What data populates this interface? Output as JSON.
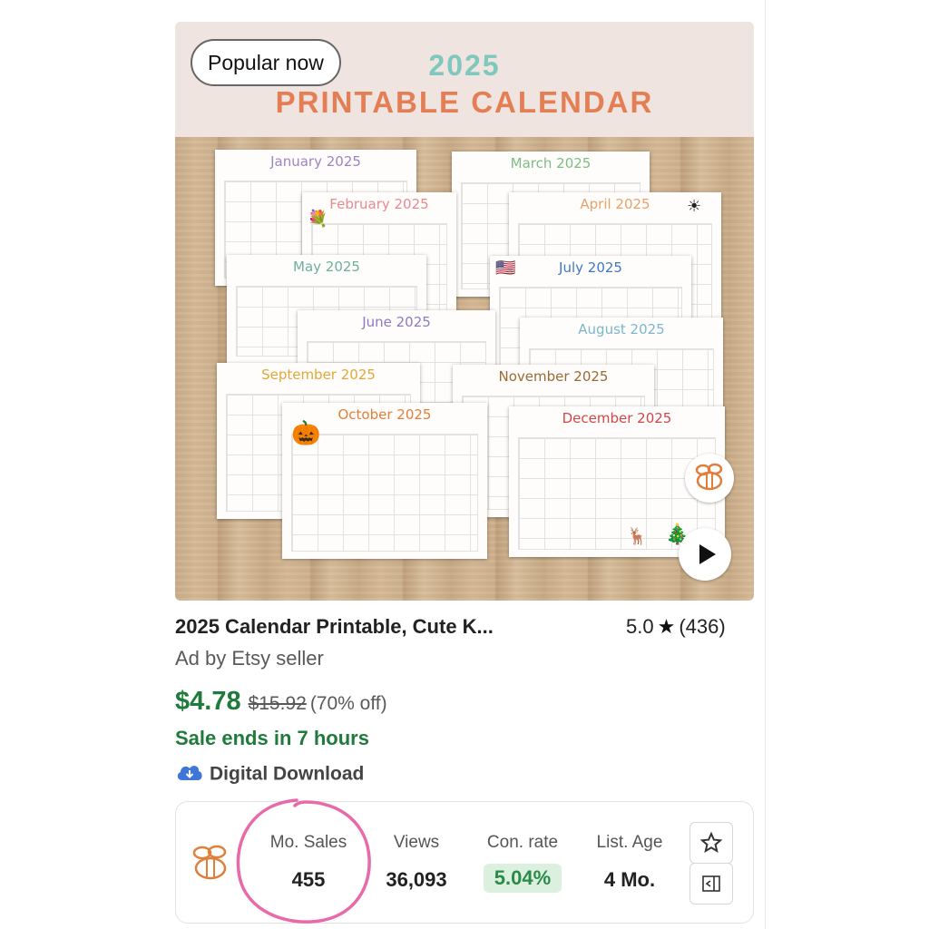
{
  "image": {
    "badge": "Popular now",
    "banner_year": "2025",
    "banner_title": "PRINTABLE CALENDAR",
    "calendars": [
      {
        "month": "January 2025",
        "color": "#9b86c4"
      },
      {
        "month": "March 2025",
        "color": "#7bbd86"
      },
      {
        "month": "February 2025",
        "color": "#e58a92"
      },
      {
        "month": "April 2025",
        "color": "#e7a268"
      },
      {
        "month": "May 2025",
        "color": "#6eaf9e"
      },
      {
        "month": "July 2025",
        "color": "#3f79c4"
      },
      {
        "month": "June 2025",
        "color": "#8d7ac0"
      },
      {
        "month": "August 2025",
        "color": "#7ab7cc"
      },
      {
        "month": "September 2025",
        "color": "#e0a83a"
      },
      {
        "month": "November 2025",
        "color": "#9a6a36"
      },
      {
        "month": "October 2025",
        "color": "#e07f3a"
      },
      {
        "month": "December 2025",
        "color": "#d2464b"
      }
    ]
  },
  "listing": {
    "title": "2025 Calendar Printable, Cute K...",
    "rating": "5.0",
    "reviews": "(436)",
    "seller": "Ad by Etsy seller",
    "price": "$4.78",
    "original_price": "$15.92",
    "discount": "(70% off)",
    "sale_ends": "Sale ends in 7 hours",
    "download": "Digital Download"
  },
  "stats": {
    "sales_label": "Mo. Sales",
    "sales_value": "455",
    "views_label": "Views",
    "views_value": "36,093",
    "conv_label": "Con. rate",
    "conv_value": "5.04%",
    "age_label": "List. Age",
    "age_value": "4 Mo."
  },
  "colors": {
    "price_green": "#207a3c",
    "accent_orange": "#e47f55",
    "accent_teal": "#7ec8bd",
    "highlight_pink": "#e86aa8"
  }
}
